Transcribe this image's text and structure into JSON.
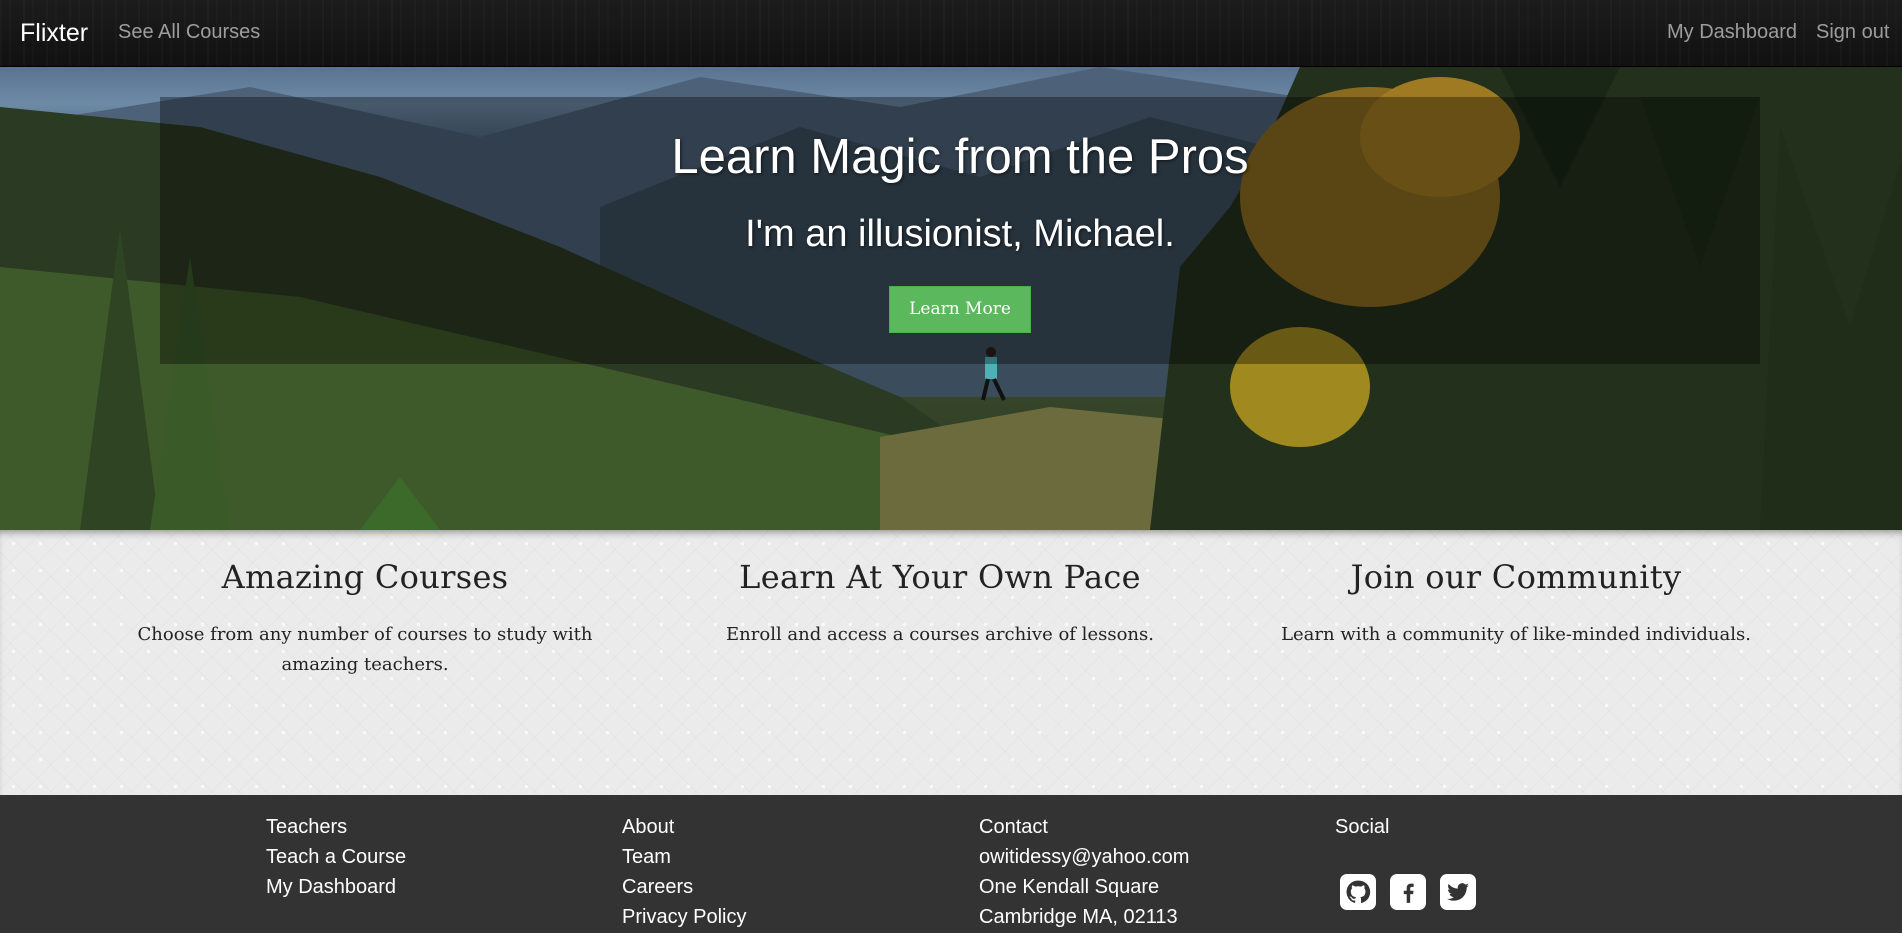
{
  "navbar": {
    "brand": "Flixter",
    "see_all_courses": "See All Courses",
    "my_dashboard": "My Dashboard",
    "sign_out": "Sign out"
  },
  "hero": {
    "title": "Learn Magic from the Pros",
    "subtitle": "I'm an illusionist, Michael.",
    "button_label": "Learn More",
    "button_color": "#5cb85c"
  },
  "features": [
    {
      "title": "Amazing Courses",
      "text": "Choose from any number of courses to study with amazing teachers."
    },
    {
      "title": "Learn At Your Own Pace",
      "text": "Enroll and access a courses archive of lessons."
    },
    {
      "title": "Join our Community",
      "text": "Learn with a community of like-minded individuals."
    }
  ],
  "footer": {
    "teachers": {
      "heading": "Teachers",
      "links": [
        "Teach a Course",
        "My Dashboard"
      ]
    },
    "about": {
      "heading": "About",
      "links": [
        "Team",
        "Careers",
        "Privacy Policy"
      ]
    },
    "contact": {
      "heading": "Contact",
      "lines": [
        "owitidessy@yahoo.com",
        "One Kendall Square",
        "Cambridge MA, 02113"
      ]
    },
    "social": {
      "heading": "Social",
      "icons": [
        "github-icon",
        "facebook-icon",
        "twitter-icon"
      ]
    }
  }
}
